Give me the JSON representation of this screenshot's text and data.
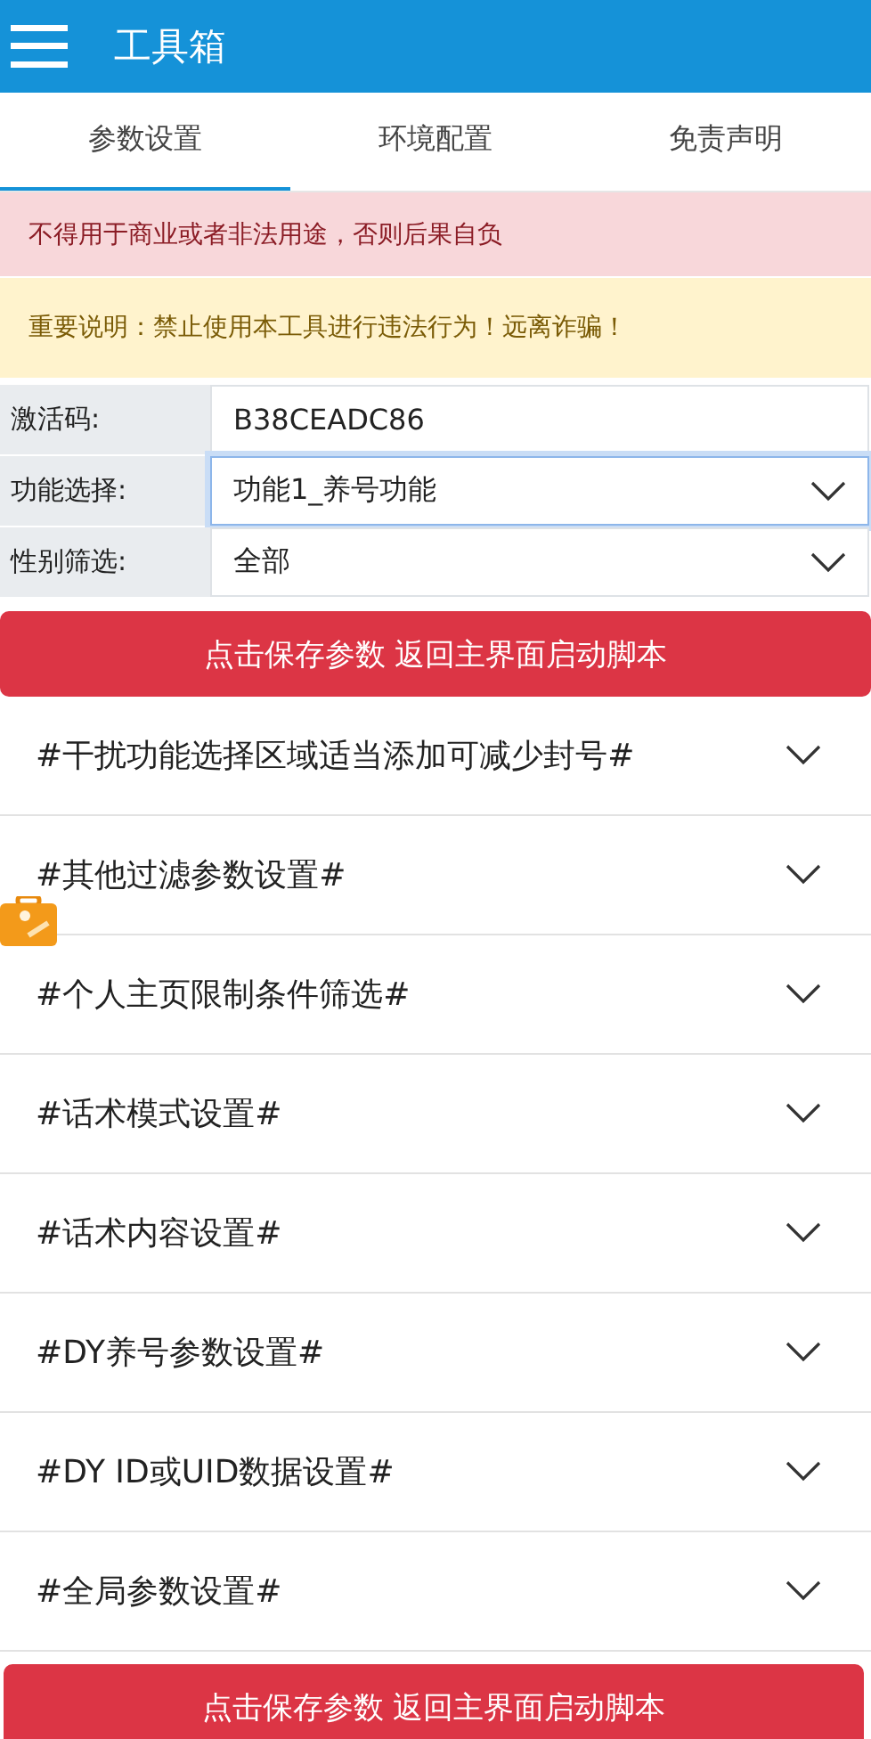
{
  "header": {
    "title": "工具箱"
  },
  "tabs": [
    {
      "label": "参数设置",
      "selected": true
    },
    {
      "label": "环境配置",
      "selected": false
    },
    {
      "label": "免责声明",
      "selected": false
    }
  ],
  "alerts": [
    {
      "kind": "danger",
      "text": "不得用于商业或者非法用途，否则后果自负"
    },
    {
      "kind": "warning",
      "text": "重要说明：禁止使用本工具进行违法行为！远离诈骗！"
    }
  ],
  "fields": [
    {
      "kind": "input",
      "label": "激活码:",
      "value": "B38CEADC86",
      "focused": false
    },
    {
      "kind": "select",
      "label": "功能选择:",
      "value": "功能1_养号功能",
      "focused": true
    },
    {
      "kind": "select",
      "label": "性别筛选:",
      "value": "全部",
      "focused": false
    }
  ],
  "save_button_top": "点击保存参数 返回主界面启动脚本",
  "sections": [
    {
      "title": "#干扰功能选择区域适当添加可减少封号#",
      "expanded": false
    },
    {
      "title": "#其他过滤参数设置#",
      "expanded": false
    },
    {
      "title": "#个人主页限制条件筛选#",
      "expanded": false
    },
    {
      "title": "#话术模式设置#",
      "expanded": false
    },
    {
      "title": "#话术内容设置#",
      "expanded": false
    },
    {
      "title": "#DY养号参数设置#",
      "expanded": false
    },
    {
      "title": "#DY ID或UID数据设置#",
      "expanded": false
    },
    {
      "title": "#全局参数设置#",
      "expanded": false
    }
  ],
  "save_button_bottom": "点击保存参数 返回主界面启动脚本"
}
